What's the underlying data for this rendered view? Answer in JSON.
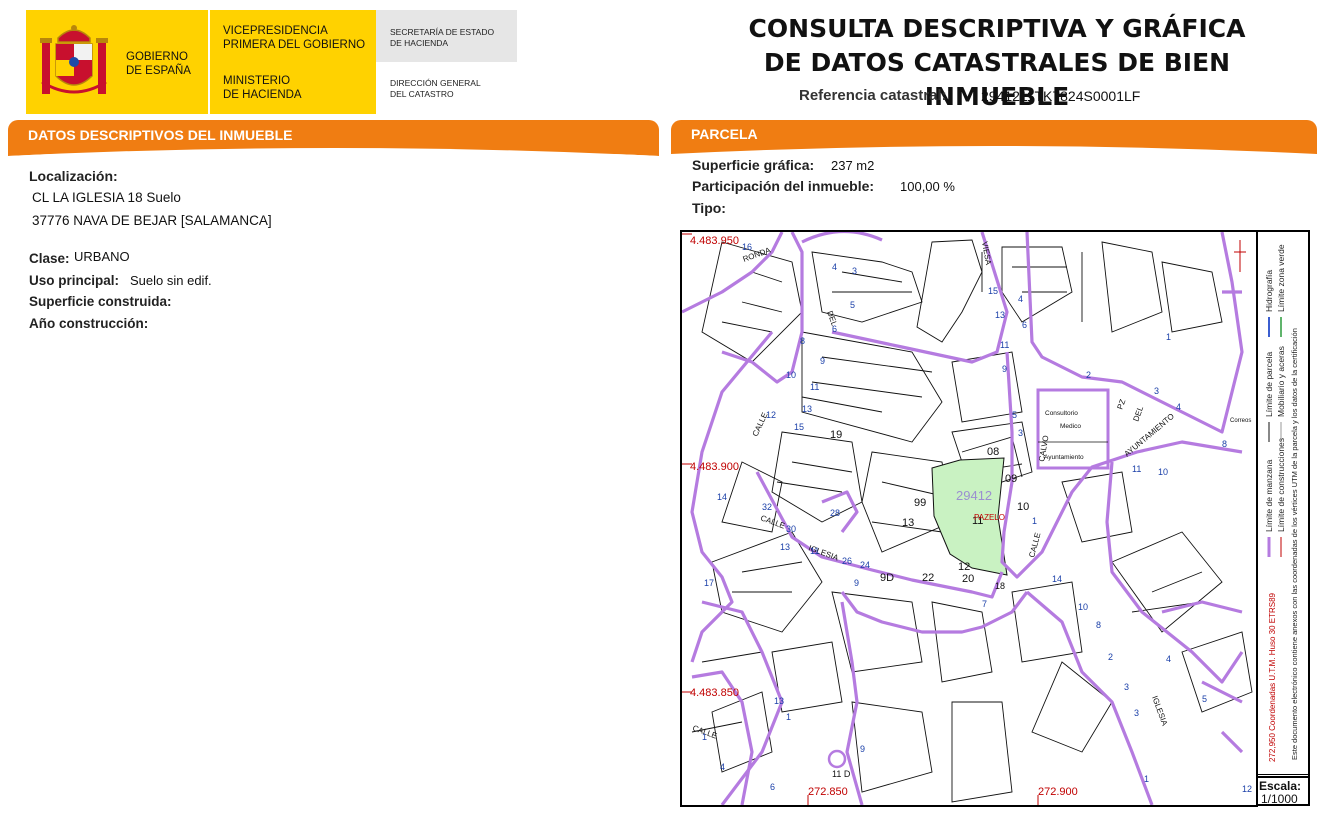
{
  "header": {
    "logo": {
      "gobierno": [
        "GOBIERNO",
        "DE ESPAÑA"
      ],
      "vicepresidencia": [
        "VICEPRESIDENCIA",
        "PRIMERA DEL GOBIERNO"
      ],
      "ministerio": [
        "MINISTERIO",
        "DE HACIENDA"
      ],
      "secretaria": [
        "SECRETARÍA DE ESTADO",
        "DE HACIENDA"
      ],
      "direccion": [
        "DIRECCIÓN GENERAL",
        "DEL CATASTRO"
      ]
    },
    "title_line1": "CONSULTA DESCRIPTIVA Y GRÁFICA",
    "title_line2": "DE DATOS CATASTRALES DE BIEN INMUEBLE",
    "refcat_label": "Referencia catastral:",
    "refcat_value": "2941211TK7824S0001LF"
  },
  "datos": {
    "section_title": "DATOS DESCRIPTIVOS DEL INMUEBLE",
    "localizacion_label": "Localización:",
    "localizacion_line1": "CL LA IGLESIA 18 Suelo",
    "localizacion_line2": "37776 NAVA DE BEJAR [SALAMANCA]",
    "clase_label": "Clase:",
    "clase_value": "URBANO",
    "uso_label": "Uso principal:",
    "uso_value": "Suelo sin edif.",
    "superficie_construida_label": "Superficie construida:",
    "anio_label": "Año construcción:"
  },
  "parcela": {
    "section_title": "PARCELA",
    "superficie_label": "Superficie gráfica:",
    "superficie_value": "237 m2",
    "participacion_label": "Participación del inmueble:",
    "participacion_value": "100,00 %",
    "tipo_label": "Tipo:"
  },
  "map": {
    "coords": {
      "y1": "4.483.950",
      "y2": "4.483.900",
      "y3": "4.483.850",
      "x1": "272.850",
      "x2": "272.900"
    },
    "parcel_number": "29412",
    "parcel_sub": "11",
    "labels": {
      "ronda": "RONDA",
      "del": "DEL",
      "calle": "CALLE",
      "iglesia": "IGLESIA",
      "iglesia2": "IGLESIA",
      "calvo": "CALVO",
      "pz": "PZ",
      "ayuntamiento_st": "AYUNTAMIENTO",
      "consultorio": "Consultorio",
      "medico": "Medico",
      "ayuntamiento_bld": "Ayuntamiento",
      "correos": "Correos",
      "viesa": "VIESA",
      "pazelo": "PAZELO",
      "n19": "19",
      "n08": "08",
      "n09": "09",
      "n10": "10",
      "n13": "13",
      "n99": "99",
      "n12": "12",
      "n20": "20",
      "n18": "18",
      "n22": "22",
      "n90": "9D",
      "n11d": "11 D"
    },
    "colors": {
      "manzana": "#b57be0",
      "parcel_fill": "#c9f2c2",
      "coord": "#c00000",
      "street_number": "#1a3fa8"
    }
  },
  "legend": {
    "items": [
      "Límite de manzana",
      "Límite de parcela",
      "Hidrografía",
      "Límite de construcciones",
      "Mobiliario y aceras",
      "Límite zona verde"
    ],
    "coords_note": "272,950 Coordenadas U.T.M. Huso 30 ETRS89",
    "cert_note": "Este documento electrónico contiene anexos con las coordenadas de los vértices UTM de la parcela y los datos de la certificación",
    "scale_label": "Escala:",
    "scale_value": "1/1000"
  }
}
